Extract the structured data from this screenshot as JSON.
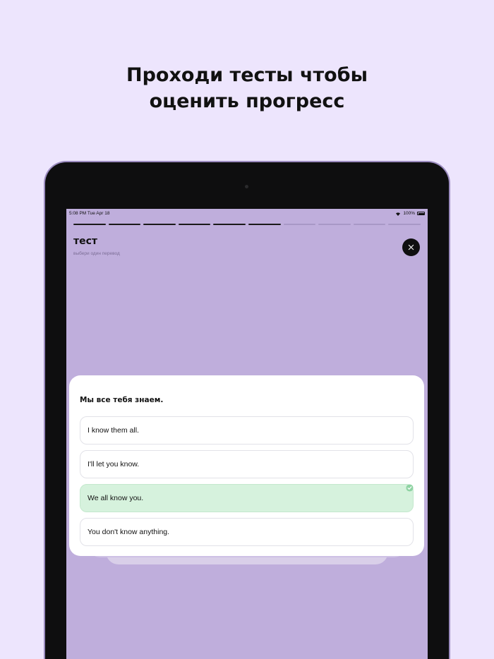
{
  "headline": {
    "line1": "Проходи тесты чтобы",
    "line2": "оценить прогресс"
  },
  "statusbar": {
    "time": "5:08 PM   Tue Apr 18",
    "battery": "100%"
  },
  "progress": {
    "completed": 6,
    "total": 10
  },
  "lesson": {
    "title": "тест",
    "subtitle": "выбери один перевод"
  },
  "quiz": {
    "question": "Мы все тебя знаем.",
    "options": [
      {
        "label": "I know them all.",
        "state": "default"
      },
      {
        "label": "I'll let you know.",
        "state": "default"
      },
      {
        "label": "We all know you.",
        "state": "correct"
      },
      {
        "label": "You don't know anything.",
        "state": "default"
      }
    ]
  },
  "colors": {
    "background": "#ede5fd",
    "screen": "#bfaedc",
    "correct": "#d6f2dd",
    "check": "#8fd3a3"
  }
}
